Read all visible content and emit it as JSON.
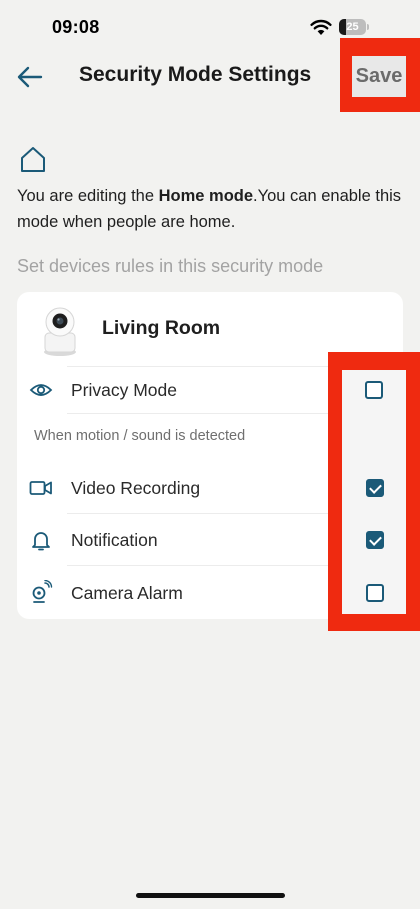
{
  "status_bar": {
    "time": "09:08",
    "battery_level": "25",
    "battery_fraction": 0.25
  },
  "header": {
    "title": "Security Mode Settings",
    "save_label": "Save"
  },
  "intro": {
    "text_before": "You are editing the ",
    "mode_name": "Home mode",
    "text_after": ".You can enable this mode when people are home."
  },
  "section_heading": "Set devices rules in this security mode",
  "device": {
    "name": "Living Room",
    "privacy": {
      "label": "Privacy Mode",
      "checked": false
    },
    "trigger_caption": "When motion / sound is detected",
    "rules": [
      {
        "label": "Video Recording",
        "icon": "video-camera-icon",
        "checked": true
      },
      {
        "label": "Notification",
        "icon": "bell-icon",
        "checked": true
      },
      {
        "label": "Camera Alarm",
        "icon": "camera-alarm-icon",
        "checked": false
      }
    ]
  },
  "colors": {
    "accent": "#1b5a78",
    "highlight": "#ef2a10",
    "background": "#f2f2f0"
  }
}
